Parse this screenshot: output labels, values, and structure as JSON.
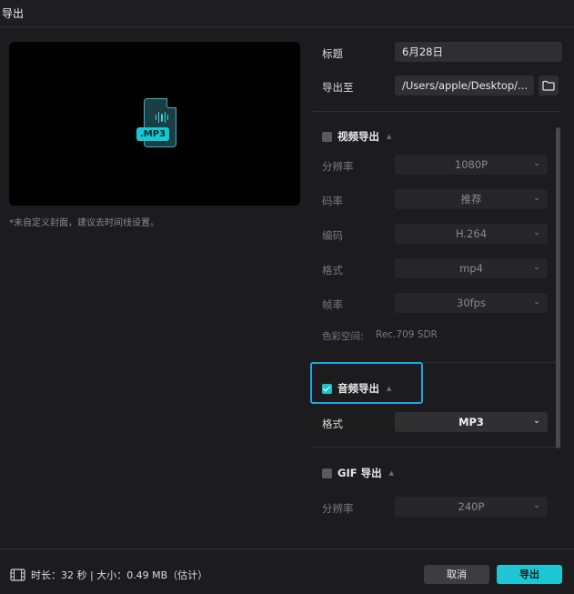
{
  "window": {
    "title": "导出"
  },
  "preview": {
    "badge": ".MP3",
    "hint": "*未自定义封面，建议去时间线设置。"
  },
  "form": {
    "title_label": "标题",
    "title_value": "6月28日",
    "export_to_label": "导出至",
    "export_to_value": "/Users/apple/Desktop/..."
  },
  "video": {
    "header": "视频导出",
    "checked": false,
    "resolution": {
      "label": "分辨率",
      "value": "1080P"
    },
    "bitrate": {
      "label": "码率",
      "value": "推荐"
    },
    "codec": {
      "label": "编码",
      "value": "H.264"
    },
    "format": {
      "label": "格式",
      "value": "mp4"
    },
    "framerate": {
      "label": "帧率",
      "value": "30fps"
    },
    "colorspace": {
      "label": "色彩空间:",
      "value": "Rec.709 SDR"
    }
  },
  "audio": {
    "header": "音频导出",
    "checked": true,
    "format": {
      "label": "格式",
      "value": "MP3"
    }
  },
  "gif": {
    "header": "GIF 导出",
    "checked": false,
    "resolution": {
      "label": "分辨率",
      "value": "240P"
    }
  },
  "footer": {
    "info": "时长：32 秒 | 大小：0.49 MB（估计）",
    "cancel": "取消",
    "export": "导出"
  },
  "colors": {
    "accent": "#1ec6d4",
    "highlight": "#19a8e6"
  }
}
